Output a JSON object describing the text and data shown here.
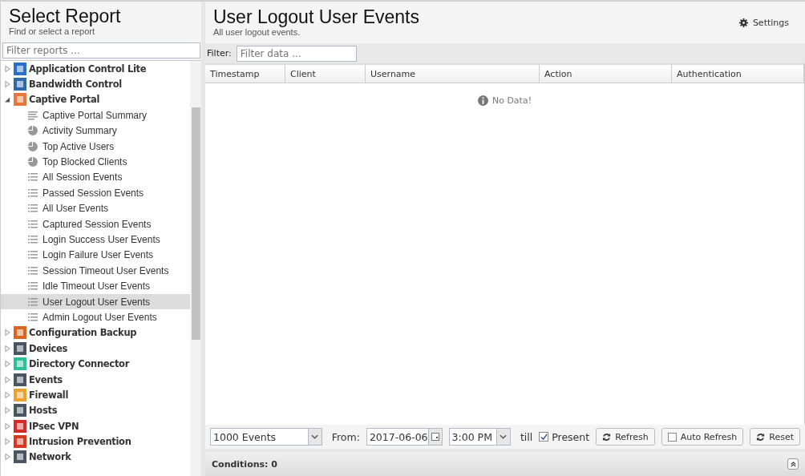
{
  "sidebar": {
    "title": "Select Report",
    "subtitle": "Find or select a report",
    "filter_placeholder": "Filter reports ...",
    "tree": [
      {
        "label": "Application Control Lite",
        "color": "#2a6fc9",
        "expanded": false
      },
      {
        "label": "Bandwidth Control",
        "color": "#2f6aa8",
        "expanded": false
      },
      {
        "label": "Captive Portal",
        "color": "#e8773a",
        "expanded": true,
        "children": [
          {
            "label": "Captive Portal Summary",
            "kind": "summary",
            "selected": false
          },
          {
            "label": "Activity Summary",
            "kind": "pie",
            "selected": false
          },
          {
            "label": "Top Active Users",
            "kind": "pie",
            "selected": false
          },
          {
            "label": "Top Blocked Clients",
            "kind": "pie",
            "selected": false
          },
          {
            "label": "All Session Events",
            "kind": "list",
            "selected": false
          },
          {
            "label": "Passed Session Events",
            "kind": "list",
            "selected": false
          },
          {
            "label": "All User Events",
            "kind": "list",
            "selected": false
          },
          {
            "label": "Captured Session Events",
            "kind": "list",
            "selected": false
          },
          {
            "label": "Login Success User Events",
            "kind": "list",
            "selected": false
          },
          {
            "label": "Login Failure User Events",
            "kind": "list",
            "selected": false
          },
          {
            "label": "Session Timeout User Events",
            "kind": "list",
            "selected": false
          },
          {
            "label": "Idle Timeout User Events",
            "kind": "list",
            "selected": false
          },
          {
            "label": "User Logout User Events",
            "kind": "list",
            "selected": true
          },
          {
            "label": "Admin Logout User Events",
            "kind": "list",
            "selected": false
          }
        ]
      },
      {
        "label": "Configuration Backup",
        "color": "#d9661f",
        "expanded": false
      },
      {
        "label": "Devices",
        "color": "#4a5563",
        "expanded": false
      },
      {
        "label": "Directory Connector",
        "color": "#2bbf9a",
        "expanded": false
      },
      {
        "label": "Events",
        "color": "#4a5563",
        "expanded": false
      },
      {
        "label": "Firewall",
        "color": "#f0a030",
        "expanded": false
      },
      {
        "label": "Hosts",
        "color": "#4a5563",
        "expanded": false
      },
      {
        "label": "IPsec VPN",
        "color": "#d62b2b",
        "expanded": false
      },
      {
        "label": "Intrusion Prevention",
        "color": "#d63a1e",
        "expanded": false
      },
      {
        "label": "Network",
        "color": "#4a5563",
        "expanded": false
      }
    ]
  },
  "report": {
    "title": "User Logout User Events",
    "description": "All user logout events.",
    "settings": "Settings",
    "filter_label": "Filter:",
    "filter_placeholder": "Filter data ...",
    "columns": [
      "Timestamp",
      "Client",
      "Username",
      "Action",
      "Authentication"
    ],
    "empty": "No Data!"
  },
  "toolbar": {
    "limit": "1000 Events",
    "from_label": "From:",
    "date": "2017-06-06",
    "time": "3:00 PM",
    "till": "till",
    "present": {
      "label": "Present",
      "checked": true
    },
    "refresh": "Refresh",
    "auto_refresh": {
      "label": "Auto Refresh",
      "checked": false
    },
    "reset": "Reset"
  },
  "conditions": "Conditions: 0"
}
